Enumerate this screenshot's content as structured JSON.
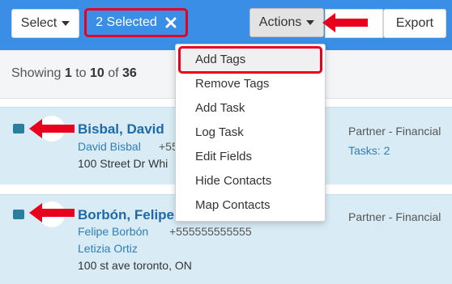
{
  "toolbar": {
    "select_label": "Select",
    "selected_label": "2 Selected",
    "actions_label": "Actions",
    "export_label": "Export"
  },
  "pagination": {
    "prefix": "Showing",
    "from": "1",
    "to_word": "to",
    "to": "10",
    "of_word": "of",
    "total": "36"
  },
  "actions_menu": {
    "items": [
      "Add Tags",
      "Remove Tags",
      "Add Task",
      "Log Task",
      "Edit Fields",
      "Hide Contacts",
      "Map Contacts"
    ]
  },
  "contacts": [
    {
      "name": "Bisbal, David",
      "person": "David Bisbal",
      "phone": "+55",
      "address": "100 Street Dr Whi",
      "role": "Partner - Financial",
      "tasks": "Tasks: 2"
    },
    {
      "name": "Borbón, Felipe",
      "person": "Felipe Borbón",
      "phone": "+555555555555",
      "person2": "Letizia Ortiz",
      "address": "100 st ave toronto, ON",
      "role": "Partner - Financial"
    }
  ],
  "colors": {
    "header_blue": "#3a8ee6",
    "row_highlight": "#d9ecf5",
    "annotation_red": "#e8001c",
    "link_blue": "#2f7db8"
  }
}
